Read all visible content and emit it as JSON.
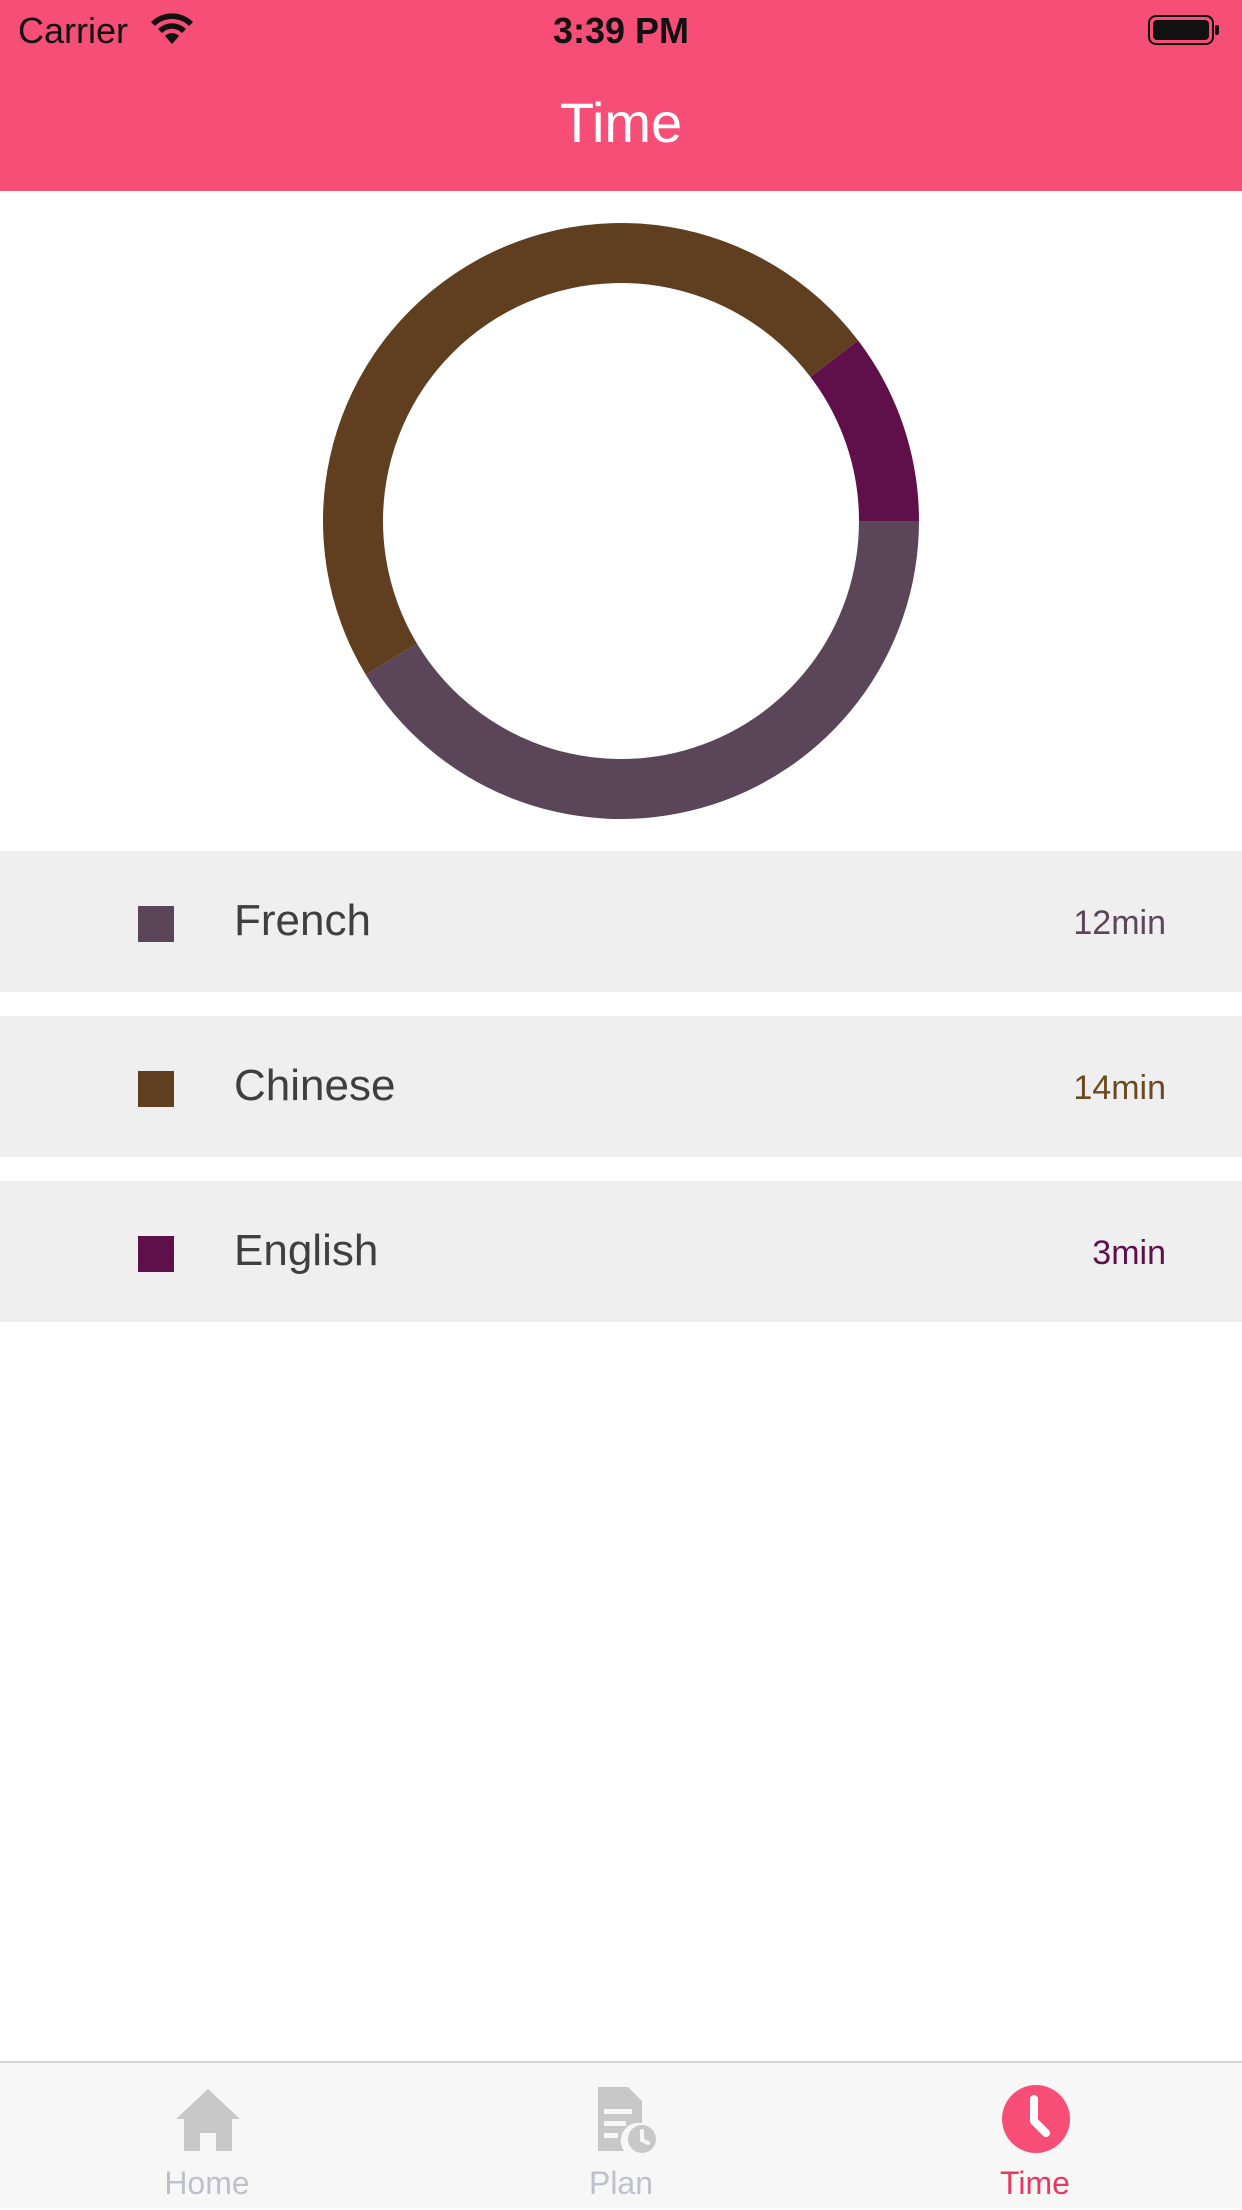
{
  "status_bar": {
    "carrier": "Carrier",
    "time": "3:39 PM"
  },
  "nav": {
    "title": "Time"
  },
  "colors": {
    "header": "#f74e77",
    "tab_active": "#f74e77",
    "tab_active_label": "#e63a61",
    "tab_inactive": "#c8c8c8",
    "tab_inactive_label": "#c0c0cc"
  },
  "chart_data": {
    "type": "pie",
    "style": "donut",
    "series": [
      {
        "name": "French",
        "value": 12,
        "color": "#5b4659"
      },
      {
        "name": "Chinese",
        "value": 14,
        "color": "#5f3f1f"
      },
      {
        "name": "English",
        "value": 3,
        "color": "#5f0f49"
      }
    ]
  },
  "legend": {
    "rows": [
      {
        "label": "French",
        "value": "12min",
        "color": "#5b4659",
        "value_color": "#5b4659"
      },
      {
        "label": "Chinese",
        "value": "14min",
        "color": "#5f3f1f",
        "value_color": "#6a4a20"
      },
      {
        "label": "English",
        "value": "3min",
        "color": "#5f0f49",
        "value_color": "#5f0f49"
      }
    ]
  },
  "tab_bar": {
    "items": [
      {
        "label": "Home",
        "icon": "home-icon",
        "active": false
      },
      {
        "label": "Plan",
        "icon": "plan-icon",
        "active": false
      },
      {
        "label": "Time",
        "icon": "clock-icon",
        "active": true
      }
    ]
  }
}
